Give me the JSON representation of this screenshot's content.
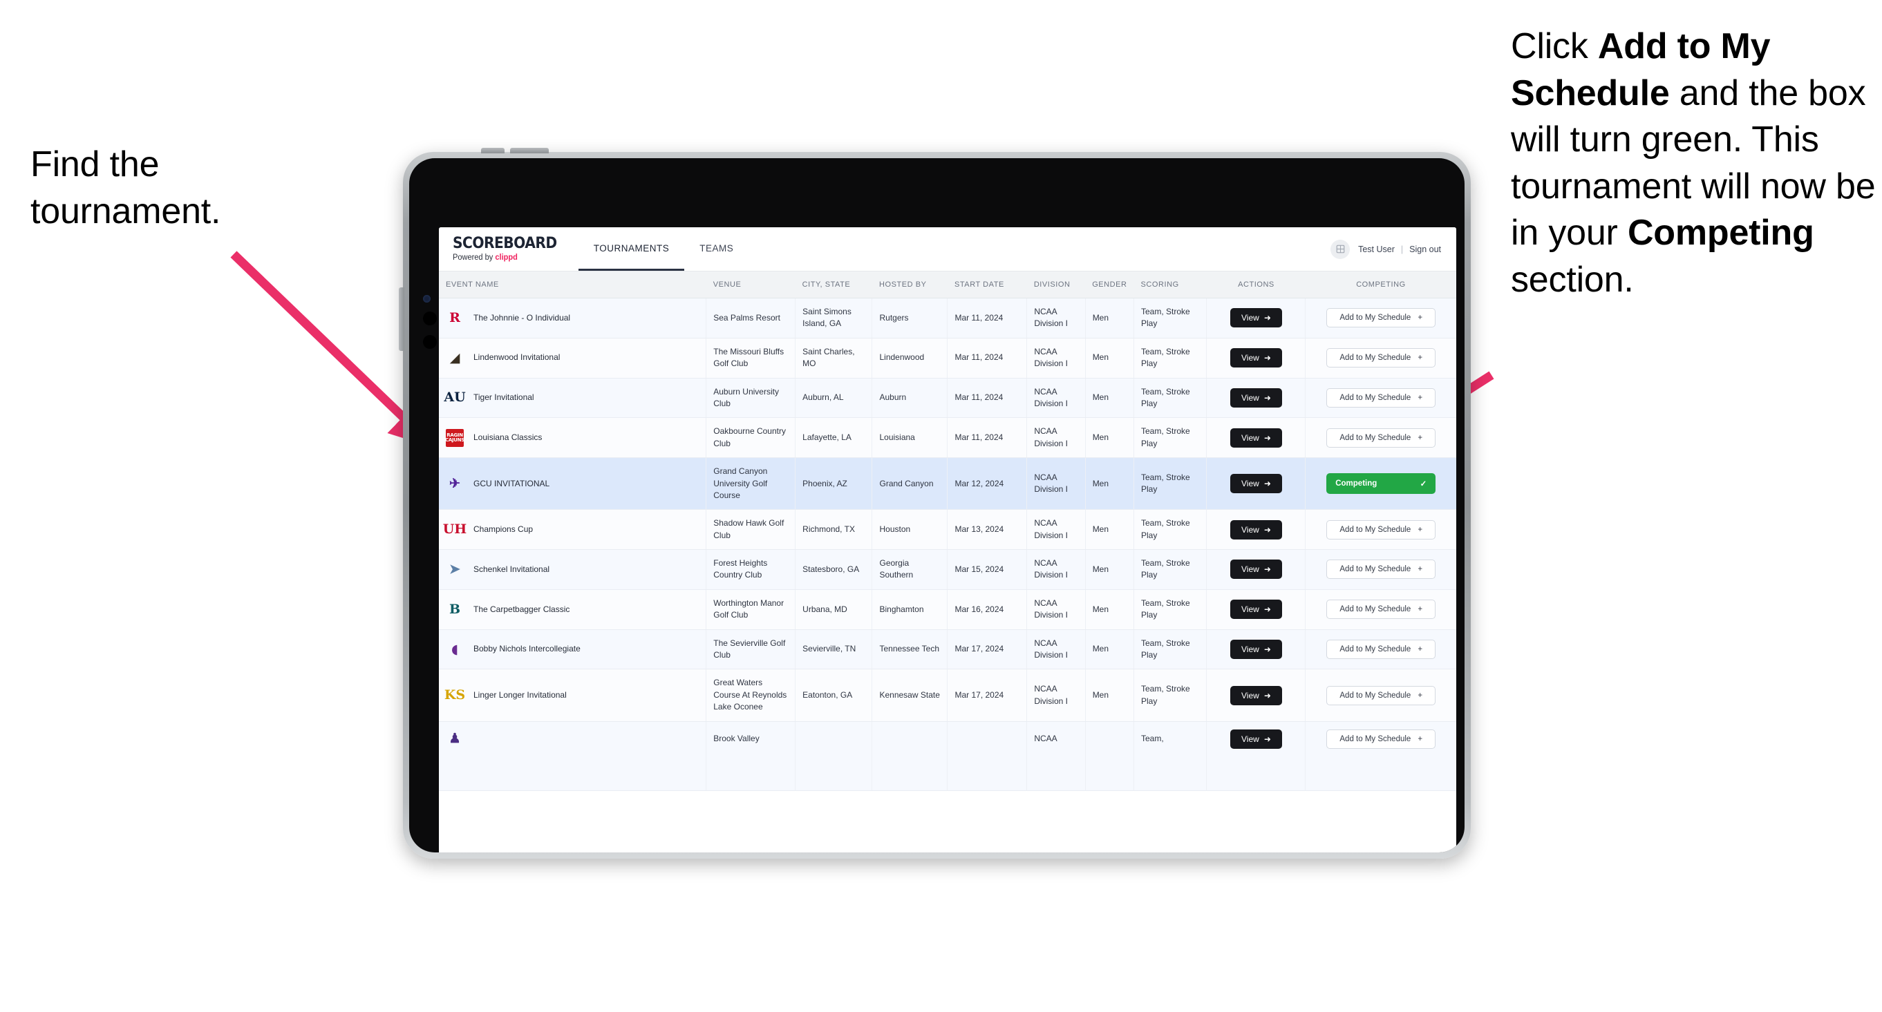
{
  "annotations": {
    "left": {
      "lines": [
        "Find the",
        "tournament."
      ]
    },
    "right": {
      "segments": [
        {
          "text": "Click ",
          "bold": false
        },
        {
          "text": "Add to My Schedule",
          "bold": true
        },
        {
          "text": " and the box will turn green. This tournament will now be in your ",
          "bold": false
        },
        {
          "text": "Competing",
          "bold": true
        },
        {
          "text": " section.",
          "bold": false
        }
      ]
    },
    "arrow_color": "#ea2f68"
  },
  "app": {
    "brand": {
      "title": "SCOREBOARD",
      "powered_prefix": "Powered by ",
      "powered_accent": "clippd"
    },
    "nav": [
      {
        "label": "TOURNAMENTS",
        "active": true
      },
      {
        "label": "TEAMS",
        "active": false
      }
    ],
    "user": {
      "avatar_icon": "user-grid-icon",
      "name": "Test User",
      "separator": "|",
      "signout": "Sign out"
    },
    "table": {
      "columns": [
        "EVENT NAME",
        "VENUE",
        "CITY, STATE",
        "HOSTED BY",
        "START DATE",
        "DIVISION",
        "GENDER",
        "SCORING",
        "ACTIONS",
        "COMPETING"
      ],
      "view_label": "View",
      "add_label": "Add to My Schedule",
      "add_plus": "+",
      "competing_label": "Competing",
      "competing_check": "✓",
      "rows": [
        {
          "logo": {
            "text": "R",
            "color": "#cc0033",
            "bg": "transparent"
          },
          "event": "The Johnnie - O Individual",
          "venue": "Sea Palms Resort",
          "city": "Saint Simons Island, GA",
          "hosted_by": "Rutgers",
          "start_date": "Mar 11, 2024",
          "division": "NCAA Division I",
          "gender": "Men",
          "scoring": "Team, Stroke Play",
          "competing": false
        },
        {
          "logo": {
            "text": "◢",
            "color": "#3a3022",
            "bg": "transparent"
          },
          "event": "Lindenwood Invitational",
          "venue": "The Missouri Bluffs Golf Club",
          "city": "Saint Charles, MO",
          "hosted_by": "Lindenwood",
          "start_date": "Mar 11, 2024",
          "division": "NCAA Division I",
          "gender": "Men",
          "scoring": "Team, Stroke Play",
          "competing": false
        },
        {
          "logo": {
            "text": "AU",
            "color": "#0c2340",
            "bg": "transparent"
          },
          "event": "Tiger Invitational",
          "venue": "Auburn University Club",
          "city": "Auburn, AL",
          "hosted_by": "Auburn",
          "start_date": "Mar 11, 2024",
          "division": "NCAA Division I",
          "gender": "Men",
          "scoring": "Team, Stroke Play",
          "competing": false
        },
        {
          "logo": {
            "text": "RAGIN CAJUNS",
            "color": "#ffffff",
            "bg": "#ce181e"
          },
          "event": "Louisiana Classics",
          "venue": "Oakbourne Country Club",
          "city": "Lafayette, LA",
          "hosted_by": "Louisiana",
          "start_date": "Mar 11, 2024",
          "division": "NCAA Division I",
          "gender": "Men",
          "scoring": "Team, Stroke Play",
          "competing": false
        },
        {
          "logo": {
            "text": "✈",
            "color": "#522398",
            "bg": "transparent"
          },
          "event": "GCU INVITATIONAL",
          "venue": "Grand Canyon University Golf Course",
          "city": "Phoenix, AZ",
          "hosted_by": "Grand Canyon",
          "start_date": "Mar 12, 2024",
          "division": "NCAA Division I",
          "gender": "Men",
          "scoring": "Team, Stroke Play",
          "competing": true,
          "selected": true
        },
        {
          "logo": {
            "text": "UH",
            "color": "#c8102e",
            "bg": "transparent"
          },
          "event": "Champions Cup",
          "venue": "Shadow Hawk Golf Club",
          "city": "Richmond, TX",
          "hosted_by": "Houston",
          "start_date": "Mar 13, 2024",
          "division": "NCAA Division I",
          "gender": "Men",
          "scoring": "Team, Stroke Play",
          "competing": false
        },
        {
          "logo": {
            "text": "➤",
            "color": "#5b7fa6",
            "bg": "transparent"
          },
          "event": "Schenkel Invitational",
          "venue": "Forest Heights Country Club",
          "city": "Statesboro, GA",
          "hosted_by": "Georgia Southern",
          "start_date": "Mar 15, 2024",
          "division": "NCAA Division I",
          "gender": "Men",
          "scoring": "Team, Stroke Play",
          "competing": false
        },
        {
          "logo": {
            "text": "B",
            "color": "#0d5c63",
            "bg": "transparent"
          },
          "event": "The Carpetbagger Classic",
          "venue": "Worthington Manor Golf Club",
          "city": "Urbana, MD",
          "hosted_by": "Binghamton",
          "start_date": "Mar 16, 2024",
          "division": "NCAA Division I",
          "gender": "Men",
          "scoring": "Team, Stroke Play",
          "competing": false
        },
        {
          "logo": {
            "text": "◖",
            "color": "#6a2c91",
            "bg": "transparent"
          },
          "event": "Bobby Nichols Intercollegiate",
          "venue": "The Sevierville Golf Club",
          "city": "Sevierville, TN",
          "hosted_by": "Tennessee Tech",
          "start_date": "Mar 17, 2024",
          "division": "NCAA Division I",
          "gender": "Men",
          "scoring": "Team, Stroke Play",
          "competing": false
        },
        {
          "logo": {
            "text": "KS",
            "color": "#d6a400",
            "bg": "transparent"
          },
          "event": "Linger Longer Invitational",
          "venue": "Great Waters Course At Reynolds Lake Oconee",
          "city": "Eatonton, GA",
          "hosted_by": "Kennesaw State",
          "start_date": "Mar 17, 2024",
          "division": "NCAA Division I",
          "gender": "Men",
          "scoring": "Team, Stroke Play",
          "competing": false
        },
        {
          "logo": {
            "text": "♟",
            "color": "#4b2e83",
            "bg": "transparent"
          },
          "event": "",
          "venue": "Brook Valley",
          "city": "",
          "hosted_by": "",
          "start_date": "",
          "division": "NCAA",
          "gender": "",
          "scoring": "Team,",
          "competing": false,
          "cut": true
        }
      ]
    }
  }
}
